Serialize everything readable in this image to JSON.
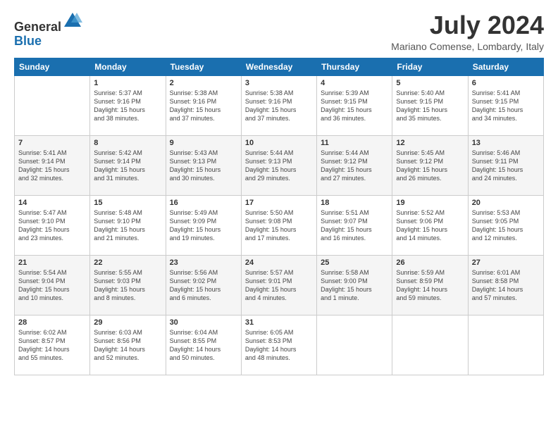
{
  "header": {
    "logo_line1": "General",
    "logo_line2": "Blue",
    "month_year": "July 2024",
    "location": "Mariano Comense, Lombardy, Italy"
  },
  "weekdays": [
    "Sunday",
    "Monday",
    "Tuesday",
    "Wednesday",
    "Thursday",
    "Friday",
    "Saturday"
  ],
  "weeks": [
    [
      {
        "day": "",
        "content": ""
      },
      {
        "day": "1",
        "content": "Sunrise: 5:37 AM\nSunset: 9:16 PM\nDaylight: 15 hours\nand 38 minutes."
      },
      {
        "day": "2",
        "content": "Sunrise: 5:38 AM\nSunset: 9:16 PM\nDaylight: 15 hours\nand 37 minutes."
      },
      {
        "day": "3",
        "content": "Sunrise: 5:38 AM\nSunset: 9:16 PM\nDaylight: 15 hours\nand 37 minutes."
      },
      {
        "day": "4",
        "content": "Sunrise: 5:39 AM\nSunset: 9:15 PM\nDaylight: 15 hours\nand 36 minutes."
      },
      {
        "day": "5",
        "content": "Sunrise: 5:40 AM\nSunset: 9:15 PM\nDaylight: 15 hours\nand 35 minutes."
      },
      {
        "day": "6",
        "content": "Sunrise: 5:41 AM\nSunset: 9:15 PM\nDaylight: 15 hours\nand 34 minutes."
      }
    ],
    [
      {
        "day": "7",
        "content": "Sunrise: 5:41 AM\nSunset: 9:14 PM\nDaylight: 15 hours\nand 32 minutes."
      },
      {
        "day": "8",
        "content": "Sunrise: 5:42 AM\nSunset: 9:14 PM\nDaylight: 15 hours\nand 31 minutes."
      },
      {
        "day": "9",
        "content": "Sunrise: 5:43 AM\nSunset: 9:13 PM\nDaylight: 15 hours\nand 30 minutes."
      },
      {
        "day": "10",
        "content": "Sunrise: 5:44 AM\nSunset: 9:13 PM\nDaylight: 15 hours\nand 29 minutes."
      },
      {
        "day": "11",
        "content": "Sunrise: 5:44 AM\nSunset: 9:12 PM\nDaylight: 15 hours\nand 27 minutes."
      },
      {
        "day": "12",
        "content": "Sunrise: 5:45 AM\nSunset: 9:12 PM\nDaylight: 15 hours\nand 26 minutes."
      },
      {
        "day": "13",
        "content": "Sunrise: 5:46 AM\nSunset: 9:11 PM\nDaylight: 15 hours\nand 24 minutes."
      }
    ],
    [
      {
        "day": "14",
        "content": "Sunrise: 5:47 AM\nSunset: 9:10 PM\nDaylight: 15 hours\nand 23 minutes."
      },
      {
        "day": "15",
        "content": "Sunrise: 5:48 AM\nSunset: 9:10 PM\nDaylight: 15 hours\nand 21 minutes."
      },
      {
        "day": "16",
        "content": "Sunrise: 5:49 AM\nSunset: 9:09 PM\nDaylight: 15 hours\nand 19 minutes."
      },
      {
        "day": "17",
        "content": "Sunrise: 5:50 AM\nSunset: 9:08 PM\nDaylight: 15 hours\nand 17 minutes."
      },
      {
        "day": "18",
        "content": "Sunrise: 5:51 AM\nSunset: 9:07 PM\nDaylight: 15 hours\nand 16 minutes."
      },
      {
        "day": "19",
        "content": "Sunrise: 5:52 AM\nSunset: 9:06 PM\nDaylight: 15 hours\nand 14 minutes."
      },
      {
        "day": "20",
        "content": "Sunrise: 5:53 AM\nSunset: 9:05 PM\nDaylight: 15 hours\nand 12 minutes."
      }
    ],
    [
      {
        "day": "21",
        "content": "Sunrise: 5:54 AM\nSunset: 9:04 PM\nDaylight: 15 hours\nand 10 minutes."
      },
      {
        "day": "22",
        "content": "Sunrise: 5:55 AM\nSunset: 9:03 PM\nDaylight: 15 hours\nand 8 minutes."
      },
      {
        "day": "23",
        "content": "Sunrise: 5:56 AM\nSunset: 9:02 PM\nDaylight: 15 hours\nand 6 minutes."
      },
      {
        "day": "24",
        "content": "Sunrise: 5:57 AM\nSunset: 9:01 PM\nDaylight: 15 hours\nand 4 minutes."
      },
      {
        "day": "25",
        "content": "Sunrise: 5:58 AM\nSunset: 9:00 PM\nDaylight: 15 hours\nand 1 minute."
      },
      {
        "day": "26",
        "content": "Sunrise: 5:59 AM\nSunset: 8:59 PM\nDaylight: 14 hours\nand 59 minutes."
      },
      {
        "day": "27",
        "content": "Sunrise: 6:01 AM\nSunset: 8:58 PM\nDaylight: 14 hours\nand 57 minutes."
      }
    ],
    [
      {
        "day": "28",
        "content": "Sunrise: 6:02 AM\nSunset: 8:57 PM\nDaylight: 14 hours\nand 55 minutes."
      },
      {
        "day": "29",
        "content": "Sunrise: 6:03 AM\nSunset: 8:56 PM\nDaylight: 14 hours\nand 52 minutes."
      },
      {
        "day": "30",
        "content": "Sunrise: 6:04 AM\nSunset: 8:55 PM\nDaylight: 14 hours\nand 50 minutes."
      },
      {
        "day": "31",
        "content": "Sunrise: 6:05 AM\nSunset: 8:53 PM\nDaylight: 14 hours\nand 48 minutes."
      },
      {
        "day": "",
        "content": ""
      },
      {
        "day": "",
        "content": ""
      },
      {
        "day": "",
        "content": ""
      }
    ]
  ]
}
